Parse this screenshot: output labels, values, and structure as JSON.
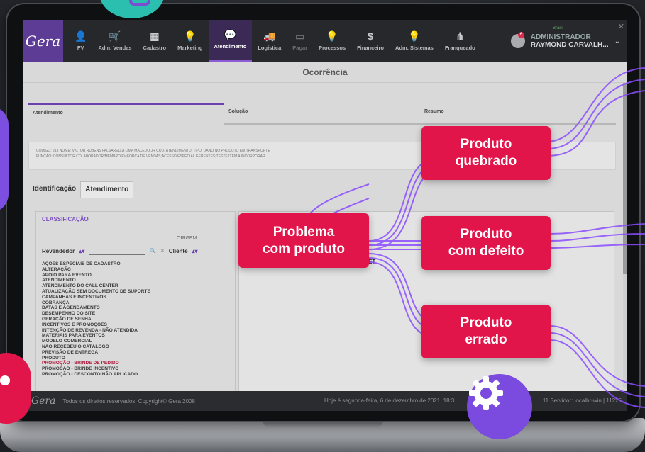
{
  "app": {
    "logo_text": "Gera",
    "nav": [
      {
        "label": "FV",
        "icon": "user-icon",
        "glyph": "👤",
        "state": "normal"
      },
      {
        "label": "Adm. Vendas",
        "icon": "cart-icon",
        "glyph": "🛒",
        "state": "normal"
      },
      {
        "label": "Cadastro",
        "icon": "id-card-icon",
        "glyph": "▦",
        "state": "normal"
      },
      {
        "label": "Marketing",
        "icon": "bulb-icon",
        "glyph": "💡",
        "state": "normal"
      },
      {
        "label": "Atendimento",
        "icon": "chat-icon",
        "glyph": "💬",
        "state": "active"
      },
      {
        "label": "Logística",
        "icon": "truck-icon",
        "glyph": "🚚",
        "state": "normal"
      },
      {
        "label": "Pagar",
        "icon": "card-icon",
        "glyph": "▭",
        "state": "dim"
      },
      {
        "label": "Processos",
        "icon": "bulb-icon",
        "glyph": "💡",
        "state": "normal"
      },
      {
        "label": "Financeiro",
        "icon": "dollar-icon",
        "glyph": "$",
        "state": "normal"
      },
      {
        "label": "Adm. Sistemas",
        "icon": "bulb-icon",
        "glyph": "💡",
        "state": "normal"
      },
      {
        "label": "Franqueado",
        "icon": "hierarchy-icon",
        "glyph": "⋔",
        "state": "normal"
      }
    ],
    "user": {
      "region": "Brasil",
      "role": "ADMINISTRADOR",
      "name": "RAYMOND CARVALH...",
      "badge": "6"
    }
  },
  "page": {
    "title": "Ocorrência",
    "steps": [
      "Atendimento",
      "Solução",
      "Resumo"
    ],
    "info_line1": "CÓDIGO: 213    NOME: VICTOR RUBENS FALSARELLA LIMA MACEDO JR    CÓD. ATENDIMENTO:    TIPO: DANO NO PRODUTO EM TRANSPORTE",
    "info_line2": "FUNÇÃO: CONSULTOR COLABORADOR/MEMBRO FV;FORÇA DE VENDAS;ACESSO ESPECIAL GERENTES;TESTE ITEM A INCORPORAR",
    "tabs": [
      "Identificação",
      "Atendimento"
    ],
    "classification": {
      "title": "CLASSIFICAÇÃO",
      "origem_label": "ORIGEM",
      "field_label": "Revendedor",
      "origem_value": "Cliente",
      "items": [
        "AÇÕES ESPECIAIS DE CADASTRO",
        "ALTERAÇÃO",
        "APOIO PARA EVENTO",
        "ATENDIMENTO",
        "ATENDIMENTO DO CALL CENTER",
        "ATUALIZAÇÃO SEM DOCUMENTO DE SUPORTE",
        "CAMPANHAS E INCENTIVOS",
        "COBRANÇA",
        "DATAS E AGENDAMENTO",
        "DESEMPENHO DO SITE",
        "GERAÇÃO DE SENHA",
        "INCENTIVOS E PROMOÇÕES",
        "INTENÇÃO DE REVENDA - NÃO ATENDIDA",
        "MATERIAIS PARA EVENTOS",
        "MODELO COMERCIAL",
        "NÃO RECEBEU O CATÁLOGO",
        "PREVISÃO DE ENTREGA",
        "PRODUTO",
        "PROMOÇÃO - BRINDE DE PEDIDO",
        "PROMOCAO - BRINDE INCENTIVO",
        "PROMOÇÃO - DESCONTO NÃO APLICADO"
      ],
      "highlighted_item": "PROMOÇÃO - BRINDE DE PEDIDO"
    },
    "right_fragment": "ET"
  },
  "footer": {
    "logo_text": "Gera",
    "copyright": "Todos os direitos reservados. Copyright© Gera 2008",
    "date": "Hoje é segunda-feira, 6 de dezembro de 2021, 18:3",
    "server": "11   Servidor: localbr-win | 11225"
  },
  "overlay": {
    "callouts": {
      "problema": "Problema\ncom produto",
      "quebrado": "Produto\nquebrado",
      "defeito": "Produto\ncom defeito",
      "errado": "Produto\nerrado"
    },
    "accent": "#e2154a",
    "line_color": "#8a4dff"
  }
}
